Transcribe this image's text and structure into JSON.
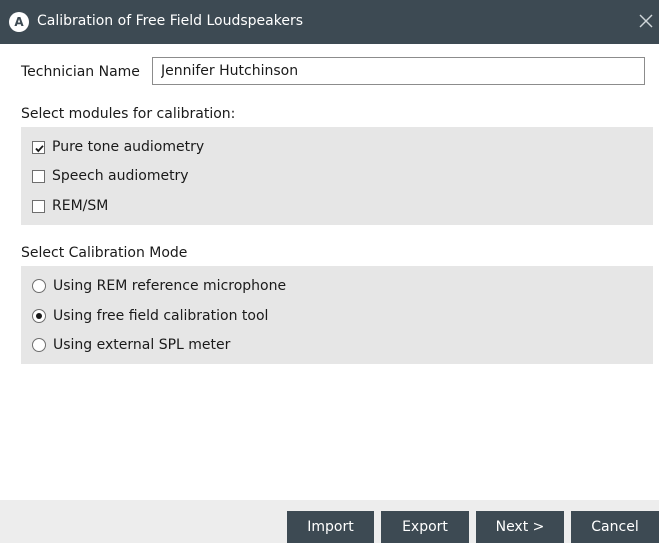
{
  "window": {
    "badge": "A",
    "title": "Calibration of Free Field Loudspeakers"
  },
  "technician": {
    "label": "Technician Name",
    "value": "Jennifer Hutchinson"
  },
  "modules": {
    "heading": "Select modules for calibration:",
    "items": [
      {
        "label": "Pure tone audiometry",
        "checked": true
      },
      {
        "label": "Speech audiometry",
        "checked": false
      },
      {
        "label": "REM/SM",
        "checked": false
      }
    ]
  },
  "mode": {
    "heading": "Select Calibration Mode",
    "items": [
      {
        "label": "Using REM reference microphone",
        "selected": false
      },
      {
        "label": "Using free field calibration tool",
        "selected": true
      },
      {
        "label": "Using external SPL meter",
        "selected": false
      }
    ]
  },
  "footer": {
    "import_label": "Import",
    "export_label": "Export",
    "next_label": "Next >",
    "cancel_label": "Cancel"
  },
  "colors": {
    "titlebar": "#3d4a53",
    "panel": "#e6e6e6",
    "button": "#3d4a53"
  },
  "icons": {
    "badge": "app-logo-icon",
    "close": "close-icon",
    "check": "checkmark-icon"
  }
}
